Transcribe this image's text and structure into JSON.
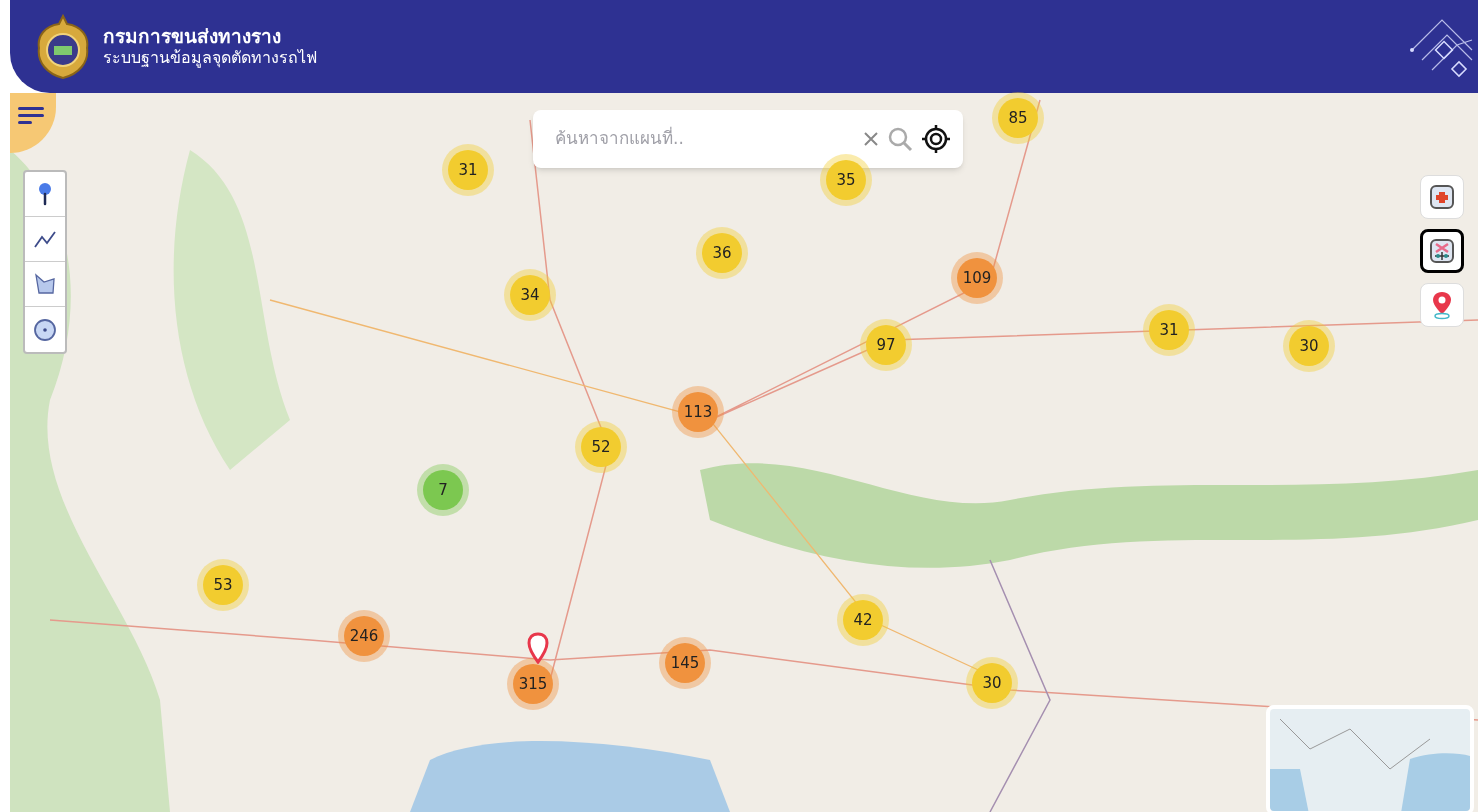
{
  "header": {
    "title": "กรมการขนส่งทางราง",
    "subtitle": "ระบบฐานข้อมูลจุดตัดทางรถไฟ"
  },
  "search": {
    "placeholder": "ค้นหาจากแผนที่.."
  },
  "draw_tools": [
    {
      "kind": "marker"
    },
    {
      "kind": "polyline"
    },
    {
      "kind": "polygon"
    },
    {
      "kind": "circle"
    }
  ],
  "side_buttons": [
    {
      "kind": "medical",
      "selected": false
    },
    {
      "kind": "crossing",
      "selected": true
    },
    {
      "kind": "pin",
      "selected": false
    }
  ],
  "clusters": [
    {
      "count": "85",
      "color": "#f2cc2f"
    },
    {
      "count": "31",
      "color": "#f2cc2f"
    },
    {
      "count": "35",
      "color": "#f2cc2f"
    },
    {
      "count": "36",
      "color": "#f2cc2f"
    },
    {
      "count": "109",
      "color": "#f0923e"
    },
    {
      "count": "34",
      "color": "#f2cc2f"
    },
    {
      "count": "97",
      "color": "#f2cc2f"
    },
    {
      "count": "31",
      "color": "#f2cc2f"
    },
    {
      "count": "30",
      "color": "#f2cc2f"
    },
    {
      "count": "113",
      "color": "#f0923e"
    },
    {
      "count": "52",
      "color": "#f2cc2f"
    },
    {
      "count": "7",
      "color": "#7cc850"
    },
    {
      "count": "53",
      "color": "#f2cc2f"
    },
    {
      "count": "42",
      "color": "#f2cc2f"
    },
    {
      "count": "246",
      "color": "#f0923e"
    },
    {
      "count": "145",
      "color": "#f0923e"
    },
    {
      "count": "315",
      "color": "#f0923e"
    },
    {
      "count": "30",
      "color": "#f2cc2f"
    }
  ]
}
